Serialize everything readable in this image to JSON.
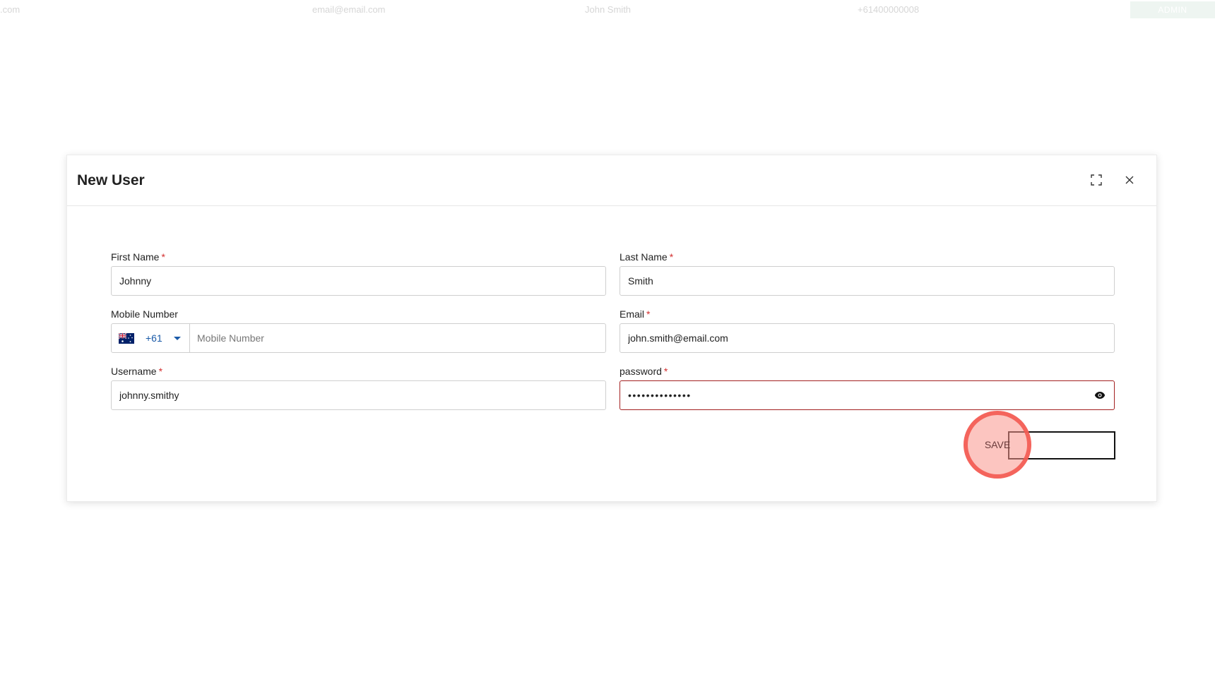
{
  "background_row": {
    "col0": ".com",
    "col1": "email@email.com",
    "col2": "John Smith",
    "col3": "+61400000008",
    "badge": "ADMIN"
  },
  "dialog": {
    "title": "New User",
    "expand_icon": "fullscreen-icon",
    "close_icon": "close-icon"
  },
  "form": {
    "first_name": {
      "label": "First Name",
      "required": "*",
      "value": "Johnny"
    },
    "last_name": {
      "label": "Last Name",
      "required": "*",
      "value": "Smith"
    },
    "mobile": {
      "label": "Mobile Number",
      "country_code": "+61",
      "flag_icon": "australia-flag-icon",
      "placeholder": "Mobile Number"
    },
    "email": {
      "label": "Email",
      "required": "*",
      "value": "john.smith@email.com"
    },
    "username": {
      "label": "Username",
      "required": "*",
      "value": "johnny.smithy"
    },
    "password": {
      "label": "password",
      "required": "*",
      "value": "••••••••••••••",
      "eye_icon": "eye-icon"
    },
    "save_label": "SAVE"
  },
  "colors": {
    "required": "#d32f2f",
    "error_border": "#a32020",
    "country_code": "#1a5aa8",
    "click_highlight": "#f45a52"
  }
}
